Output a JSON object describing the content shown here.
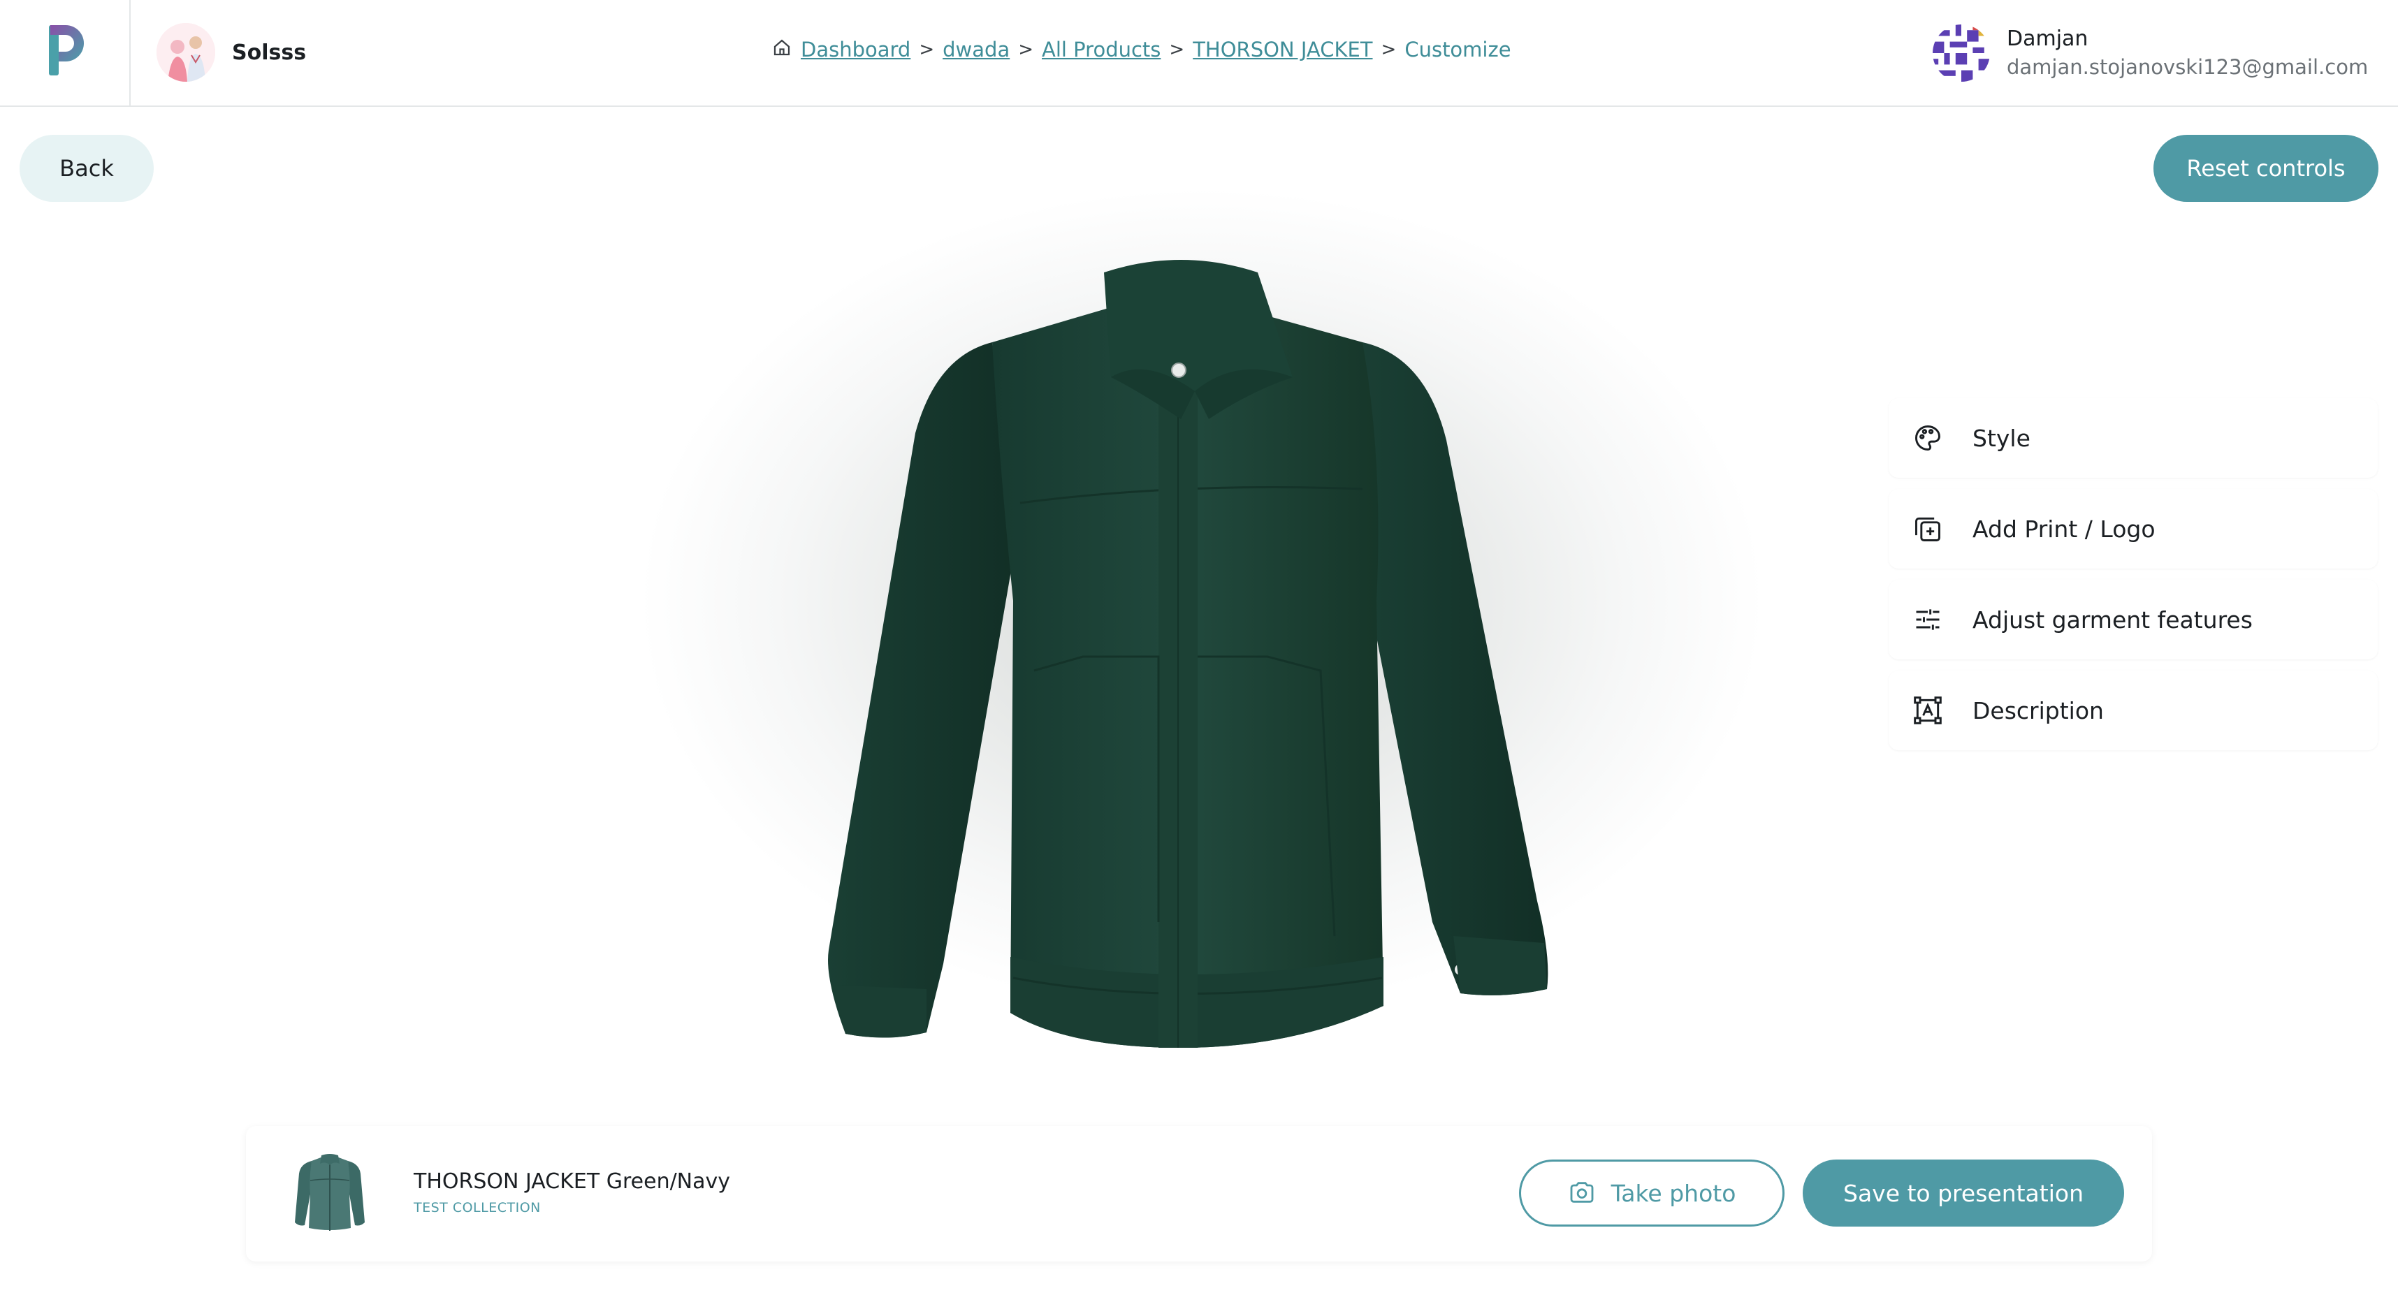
{
  "brand": {
    "name": "Solsss"
  },
  "breadcrumb": [
    {
      "label": "Dashboard"
    },
    {
      "label": "dwada"
    },
    {
      "label": "All Products"
    },
    {
      "label": "THORSON JACKET"
    },
    {
      "label": "Customize"
    }
  ],
  "breadcrumb_separator": ">",
  "user": {
    "name": "Damjan",
    "email": "damjan.stojanovski123@gmail.com"
  },
  "controls": {
    "back_label": "Back",
    "reset_label": "Reset controls"
  },
  "menu": {
    "items": [
      {
        "label": "Style",
        "icon": "palette-icon"
      },
      {
        "label": "Add Print / Logo",
        "icon": "add-layer-icon"
      },
      {
        "label": "Adjust garment features",
        "icon": "sliders-icon"
      },
      {
        "label": "Description",
        "icon": "text-frame-icon"
      }
    ]
  },
  "product": {
    "title": "THORSON JACKET Green/Navy",
    "collection": "TEST COLLECTION"
  },
  "actions": {
    "take_photo_label": "Take photo",
    "save_label": "Save to presentation"
  },
  "colors": {
    "accent": "#4f9aa5",
    "garment": "#1d4439",
    "back_bg": "#e7f3f4"
  }
}
